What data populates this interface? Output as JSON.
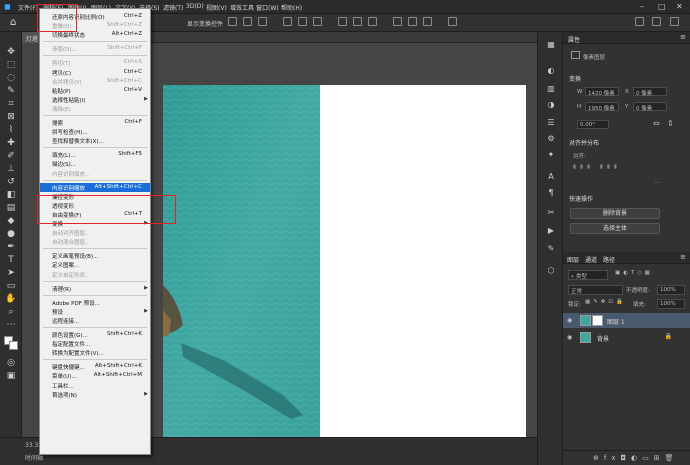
{
  "menubar": {
    "items": [
      "文件(F)",
      "编辑(E)",
      "图像(I)",
      "图层(L)",
      "文字(Y)",
      "选择(S)",
      "滤镜(T)",
      "3D(D)",
      "视图(V)",
      "增效工具",
      "窗口(W)",
      "帮助(H)"
    ]
  },
  "options": {
    "transform_label": "显示变换控件"
  },
  "document_tab": "灯塔",
  "status": {
    "zoom": "33.33%",
    "info": "时间轴"
  },
  "edit_menu": {
    "items": [
      {
        "label": "还原内容识别比例(O)",
        "key": "Ctrl+Z",
        "disabled": false
      },
      {
        "label": "重做(O)",
        "key": "Shift+Ctrl+Z",
        "disabled": true
      },
      {
        "label": "切换最终状态",
        "key": "Alt+Ctrl+Z",
        "disabled": false
      },
      {
        "sep": true
      },
      {
        "label": "渐隐(D)...",
        "key": "Shift+Ctrl+F",
        "disabled": true
      },
      {
        "sep": true
      },
      {
        "label": "剪切(T)",
        "key": "Ctrl+X",
        "disabled": true
      },
      {
        "label": "拷贝(C)",
        "key": "Ctrl+C",
        "disabled": false
      },
      {
        "label": "合并拷贝(Y)",
        "key": "Shift+Ctrl+C",
        "disabled": true
      },
      {
        "label": "粘贴(P)",
        "key": "Ctrl+V",
        "disabled": false
      },
      {
        "label": "选择性粘贴(I)",
        "key": "",
        "disabled": false,
        "submenu": true
      },
      {
        "label": "清除(E)",
        "key": "",
        "disabled": true
      },
      {
        "sep": true
      },
      {
        "label": "搜索",
        "key": "Ctrl+F",
        "disabled": false
      },
      {
        "label": "拼写检查(H)...",
        "key": "",
        "disabled": false
      },
      {
        "label": "查找和替换文本(X)...",
        "key": "",
        "disabled": false
      },
      {
        "sep": true
      },
      {
        "label": "填充(L)...",
        "key": "Shift+F5",
        "disabled": false
      },
      {
        "label": "描边(S)...",
        "key": "",
        "disabled": false
      },
      {
        "label": "内容识别填充...",
        "key": "",
        "disabled": true
      },
      {
        "sep": true
      },
      {
        "label": "内容识别缩放",
        "key": "Alt+Shift+Ctrl+C",
        "disabled": false,
        "highlight": true
      },
      {
        "label": "操控变形",
        "key": "",
        "disabled": false
      },
      {
        "label": "透视变形",
        "key": "",
        "disabled": false
      },
      {
        "label": "自由变换(F)",
        "key": "Ctrl+T",
        "disabled": false
      },
      {
        "label": "变换",
        "key": "",
        "disabled": false,
        "submenu": true
      },
      {
        "label": "自动对齐图层...",
        "key": "",
        "disabled": true
      },
      {
        "label": "自动混合图层...",
        "key": "",
        "disabled": true
      },
      {
        "sep": true
      },
      {
        "label": "定义画笔预设(B)...",
        "key": "",
        "disabled": false
      },
      {
        "label": "定义图案...",
        "key": "",
        "disabled": false
      },
      {
        "label": "定义自定形状...",
        "key": "",
        "disabled": true
      },
      {
        "sep": true
      },
      {
        "label": "清理(R)",
        "key": "",
        "disabled": false,
        "submenu": true
      },
      {
        "sep": true
      },
      {
        "label": "Adobe PDF 预设...",
        "key": "",
        "disabled": false
      },
      {
        "label": "预设",
        "key": "",
        "disabled": false,
        "submenu": true
      },
      {
        "label": "远程连接...",
        "key": "",
        "disabled": false
      },
      {
        "sep": true
      },
      {
        "label": "颜色设置(G)...",
        "key": "Shift+Ctrl+K",
        "disabled": false
      },
      {
        "label": "指定配置文件...",
        "key": "",
        "disabled": false
      },
      {
        "label": "转换为配置文件(V)...",
        "key": "",
        "disabled": false
      },
      {
        "sep": true
      },
      {
        "label": "键盘快捷键...",
        "key": "Alt+Shift+Ctrl+K",
        "disabled": false
      },
      {
        "label": "菜单(U)...",
        "key": "Alt+Shift+Ctrl+M",
        "disabled": false
      },
      {
        "label": "工具栏...",
        "key": "",
        "disabled": false
      },
      {
        "label": "首选项(N)",
        "key": "",
        "disabled": false,
        "submenu": true
      }
    ]
  },
  "properties": {
    "title": "属性",
    "pixel_layer": "像素图层",
    "transform_title": "变换",
    "w_label": "W",
    "w_value": "1420 像素",
    "h_label": "H",
    "h_value": "1950 像素",
    "x_label": "X",
    "x_value": "0 像素",
    "y_label": "Y",
    "y_value": "0 像素",
    "angle": "0.00°",
    "align_title": "对齐并分布",
    "align_label": "对齐:",
    "quick_title": "快速操作",
    "remove_bg": "删除背景",
    "select_subject": "选择主体"
  },
  "layers": {
    "tabs": [
      "图层",
      "通道",
      "路径"
    ],
    "filter": "类型",
    "blend": "正常",
    "opacity_label": "不透明度:",
    "opacity": "100%",
    "lock_label": "锁定:",
    "fill_label": "填充:",
    "fill": "100%",
    "items": [
      {
        "name": "图层 1"
      },
      {
        "name": "背景"
      }
    ]
  },
  "colors": {
    "accent": "#1a6ed8",
    "highlight_box": "#e0252a",
    "water": "#3fa7a0"
  }
}
